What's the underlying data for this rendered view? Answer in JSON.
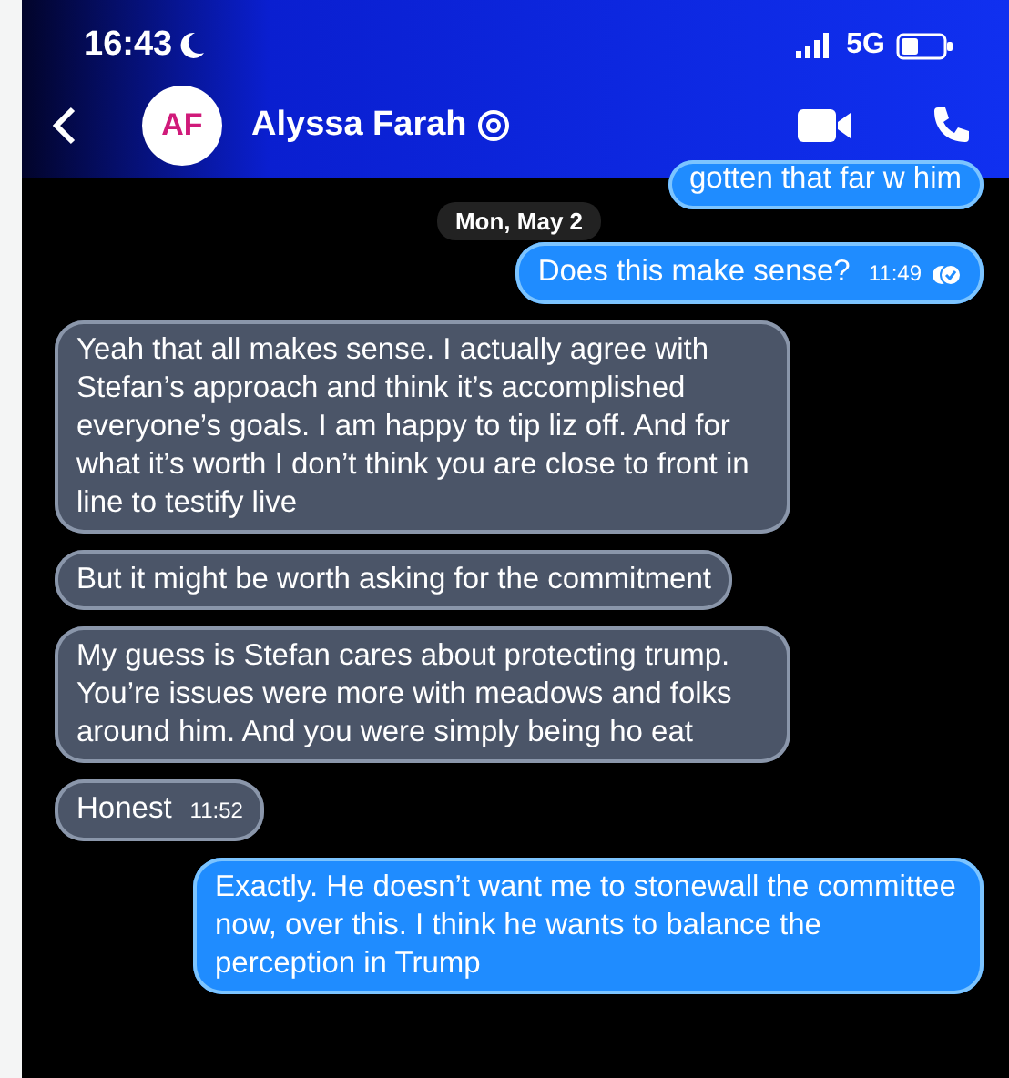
{
  "status_bar": {
    "time": "16:43",
    "network": "5G"
  },
  "header": {
    "avatar": "AF",
    "name": "Alyssa Farah"
  },
  "messages": [
    {
      "kind": "outgoing",
      "text": "gotten that far w him"
    },
    {
      "kind": "date",
      "text": "Mon, May 2"
    },
    {
      "kind": "outgoing",
      "text": "Does this make sense?",
      "time": "11:49",
      "read": true
    },
    {
      "kind": "incoming",
      "text": "Yeah that all makes sense. I actually agree with Stefan’s approach and think it’s accomplished everyone’s goals. I am happy to tip liz off. And for what it’s worth I don’t think you are close to front in line to testify live"
    },
    {
      "kind": "incoming",
      "text": "But it might be worth asking for the commitment"
    },
    {
      "kind": "incoming",
      "text": "My guess is Stefan cares about protecting trump. You’re issues were more with meadows and folks around him. And you were simply being ho eat"
    },
    {
      "kind": "incoming",
      "text": "Honest",
      "time": "11:52"
    },
    {
      "kind": "outgoing",
      "text": "Exactly. He doesn’t want me to stonewall the committee now, over this. I think he wants to balance the perception in Trump"
    }
  ]
}
